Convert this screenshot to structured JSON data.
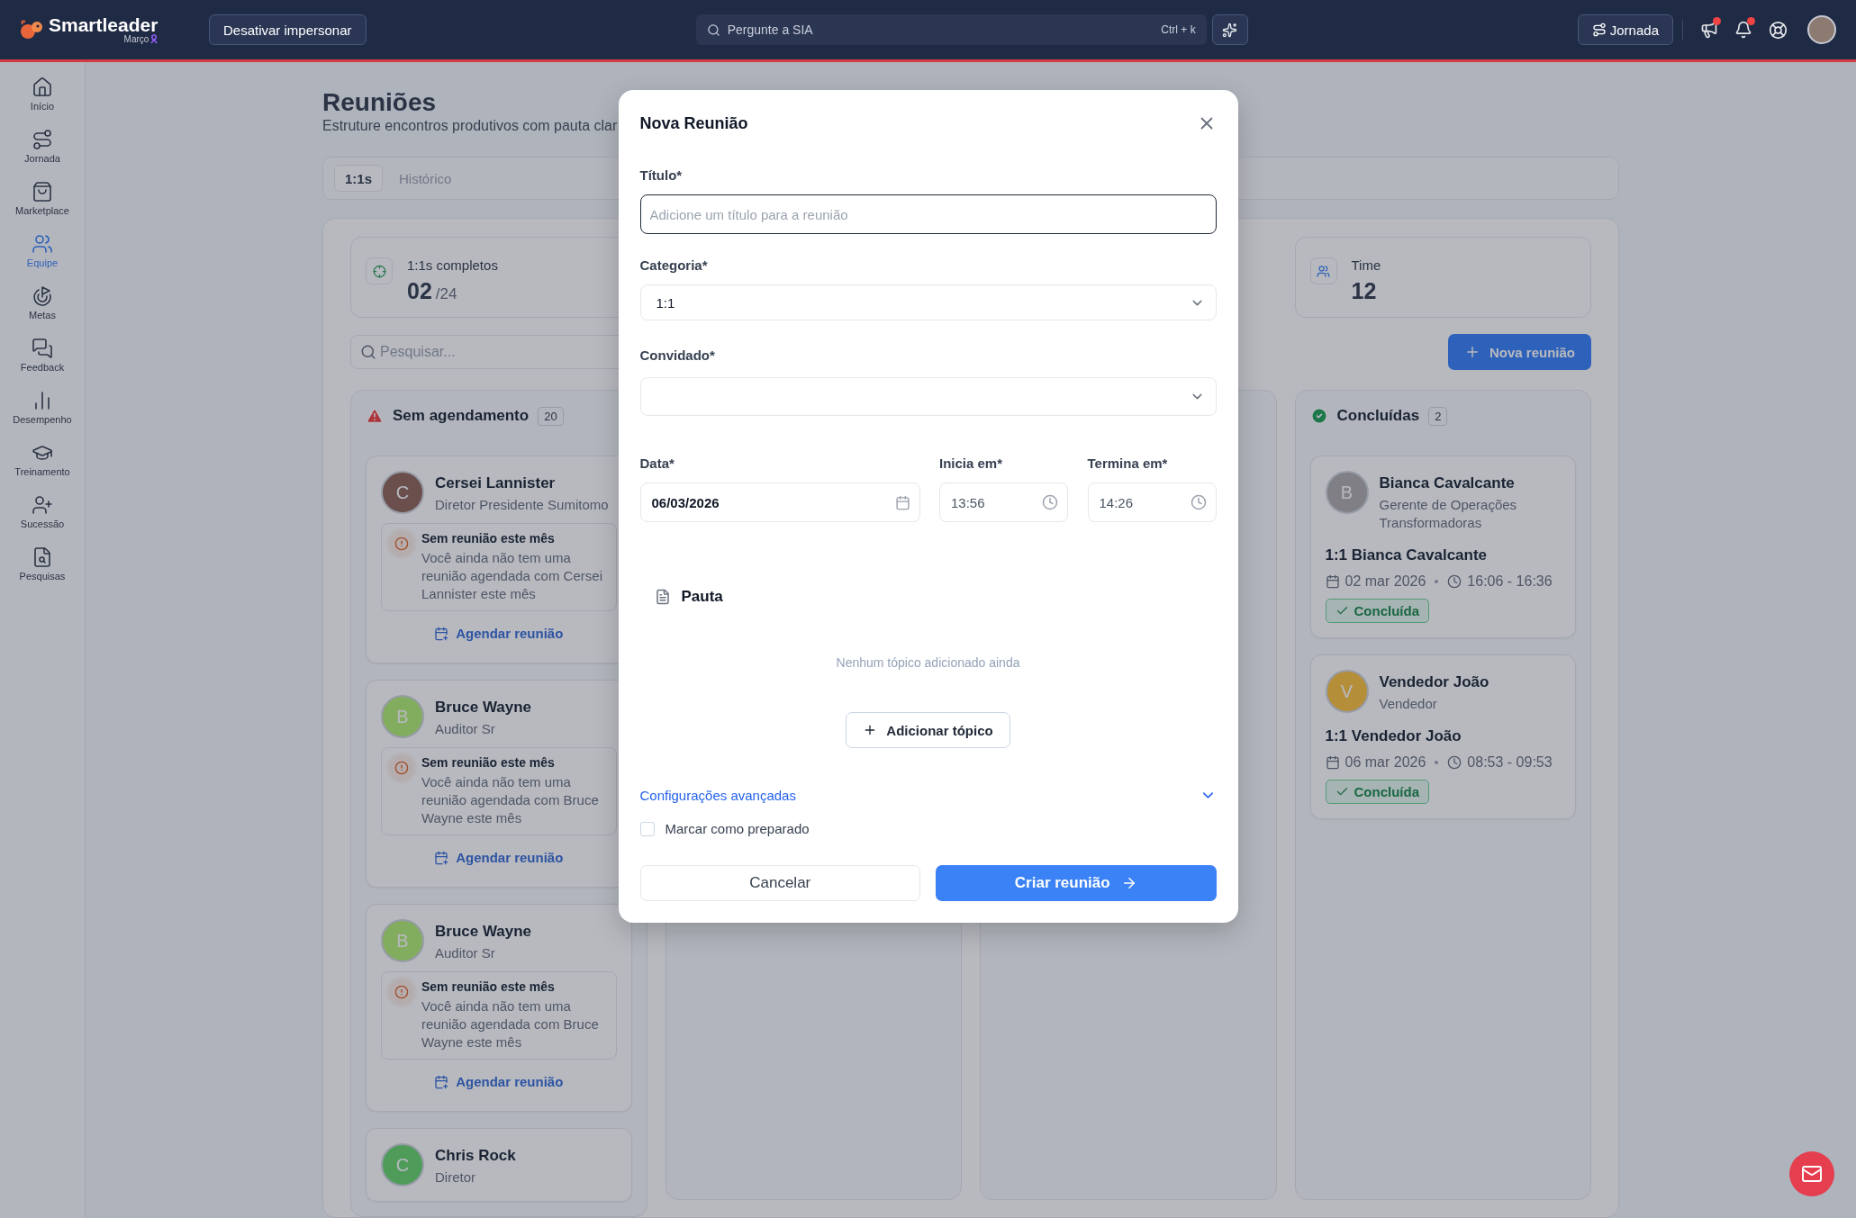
{
  "topbar": {
    "brand": "Smartleader",
    "brand_sub": "Março",
    "impersonate_button": "Desativar impersonar",
    "search": {
      "placeholder": "Pergunte a SIA",
      "shortcut": "Ctrl + k"
    },
    "journey_button": "Jornada",
    "announcements_unread": true,
    "notifications_unread": true
  },
  "sidebar": {
    "items": [
      {
        "label": "Início",
        "selected": false
      },
      {
        "label": "Jornada",
        "selected": false
      },
      {
        "label": "Marketplace",
        "selected": false
      },
      {
        "label": "Equipe",
        "selected": true
      },
      {
        "label": "Metas",
        "selected": false
      },
      {
        "label": "Feedback",
        "selected": false
      },
      {
        "label": "Desempenho",
        "selected": false
      },
      {
        "label": "Treinamento",
        "selected": false
      },
      {
        "label": "Sucessão",
        "selected": false
      },
      {
        "label": "Pesquisas",
        "selected": false
      }
    ]
  },
  "page": {
    "title": "Reuniões",
    "subtitle": "Estruture encontros produtivos com pauta clar",
    "tabs": [
      {
        "label": "1:1s",
        "selected": true
      },
      {
        "label": "Histórico",
        "selected": false
      }
    ],
    "stats": [
      {
        "label": "1:1s completos",
        "value": "02",
        "total": "/24"
      },
      {
        "label": "Time",
        "value": "12"
      }
    ],
    "search_placeholder": "Pesquisar...",
    "new_meeting_button": "Nova reunião",
    "columns": [
      {
        "title": "Sem agendamento",
        "count": "20",
        "kind": "alert",
        "cards": [
          {
            "kind": "unscheduled",
            "name": "Cersei Lannister",
            "role": "Diretor Presidente Sumitomo",
            "initial": "C",
            "color": "#6a4f4c",
            "warning_title": "Sem reunião este mês",
            "warning_text": "Você ainda não tem uma reunião agendada com Cersei Lannister este mês",
            "action": "Agendar reunião"
          },
          {
            "kind": "unscheduled",
            "name": "Bruce Wayne",
            "role": "Auditor Sr",
            "initial": "B",
            "color": "#82ad5e",
            "warning_title": "Sem reunião este mês",
            "warning_text": "Você ainda não tem uma reunião agendada com Bruce Wayne este mês",
            "action": "Agendar reunião"
          },
          {
            "kind": "unscheduled",
            "name": "Bruce Wayne",
            "role": "Auditor Sr",
            "initial": "B",
            "color": "#82ad5e",
            "warning_title": "Sem reunião este mês",
            "warning_text": "Você ainda não tem uma reunião agendada com Bruce Wayne este mês",
            "action": "Agendar reunião"
          },
          {
            "kind": "unscheduled",
            "name": "Chris Rock",
            "role": "Diretor",
            "initial": "C",
            "color": "#4f9c5a"
          }
        ]
      },
      {
        "title": "Concluídas",
        "count": "2",
        "kind": "done",
        "cards": [
          {
            "kind": "completed",
            "name": "Bianca Cavalcante",
            "role": "Gerente de Operações Transformadoras",
            "initial": "B",
            "color": "#7f8085",
            "meeting": "1:1 Bianca Cavalcante",
            "date": "02 mar 2026",
            "time": "16:06 - 16:36",
            "badge": "Concluída"
          },
          {
            "kind": "completed",
            "name": "Vendedor João",
            "role": "Vendedor",
            "initial": "V",
            "color": "#b58f3a",
            "meeting": "1:1 Vendedor João",
            "date": "06 mar 2026",
            "time": "08:53 - 09:53",
            "badge": "Concluída"
          }
        ]
      }
    ]
  },
  "modal": {
    "title": "Nova Reunião",
    "fields": [
      {
        "kind": "text",
        "label": "Título*",
        "placeholder": "Adicione um título para a reunião",
        "focused": true
      },
      {
        "kind": "select",
        "label": "Categoria*",
        "value": "1:1"
      },
      {
        "kind": "select",
        "label": "Convidado*"
      }
    ],
    "schedule": [
      {
        "kind": "date",
        "label": "Data*",
        "value": "06/03/2026"
      },
      {
        "kind": "time",
        "label": "Inicia em*",
        "value": "13:56"
      },
      {
        "kind": "time",
        "label": "Termina em*",
        "value": "14:26"
      }
    ],
    "agenda": {
      "title": "Pauta",
      "empty_text": "Nenhum tópico adicionado ainda",
      "add_button": "Adicionar tópico"
    },
    "advanced": {
      "label": "Configurações avançadas",
      "expanded": false
    },
    "prepared": {
      "label": "Marcar como preparado",
      "checked": false
    },
    "buttons": [
      {
        "kind": "secondary",
        "label": "Cancelar"
      },
      {
        "kind": "primary",
        "label": "Criar reunião"
      }
    ]
  }
}
